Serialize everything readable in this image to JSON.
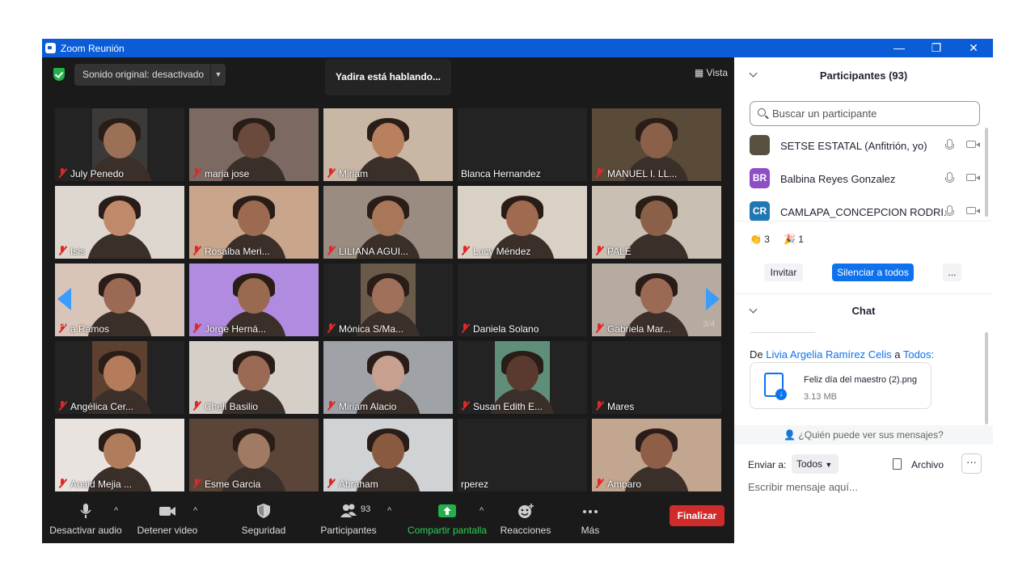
{
  "window": {
    "title": "Zoom Reunión",
    "minimize": "—",
    "restore": "❐",
    "close": "✕"
  },
  "top": {
    "sound_label": "Sonido original: desactivado",
    "speaking": "Yadira está hablando...",
    "view_label": "Vista"
  },
  "gallery": {
    "page_left": "3/4",
    "page_right": "3/4"
  },
  "tiles": [
    {
      "name": "July Penedo",
      "muted": true,
      "video": "person",
      "bg": "#3c3a38",
      "skin": "#9b7057"
    },
    {
      "name": "maria jose",
      "muted": true,
      "video": "person",
      "bg": "#7c6a62",
      "skin": "#6a4a3c"
    },
    {
      "name": "Miriam",
      "muted": true,
      "video": "person",
      "bg": "#c8b7a5",
      "skin": "#b9805f"
    },
    {
      "name": "Blanca Hernandez",
      "muted": false,
      "video": "none"
    },
    {
      "name": "MANUEL I. LL...",
      "muted": true,
      "video": "person",
      "bg": "#5a4a38",
      "skin": "#8a6048"
    },
    {
      "name": "Isis",
      "muted": true,
      "video": "person",
      "bg": "#ddd7cf",
      "skin": "#c08a6a"
    },
    {
      "name": "Rosalba Meri...",
      "muted": true,
      "video": "person",
      "bg": "#c9a58b",
      "skin": "#9b6a50"
    },
    {
      "name": "LILIANA AGUI...",
      "muted": true,
      "video": "person",
      "bg": "#9a8c80",
      "skin": "#a87658"
    },
    {
      "name": "Lucy Méndez",
      "muted": true,
      "video": "person",
      "bg": "#d9d0c6",
      "skin": "#a06a50"
    },
    {
      "name": "PALE",
      "muted": true,
      "video": "person",
      "bg": "#c9bfb3",
      "skin": "#8a6048"
    },
    {
      "name": "a Ramos",
      "muted": true,
      "video": "person",
      "bg": "#d8c4b8",
      "skin": "#9a6a55"
    },
    {
      "name": "Jorge Herná...",
      "muted": true,
      "video": "person",
      "bg": "#b18be0",
      "skin": "#9a6a50"
    },
    {
      "name": "Mónica S/Ma...",
      "muted": true,
      "video": "person",
      "bg": "#6a5a4a",
      "skin": "#a0705a"
    },
    {
      "name": "Daniela Solano",
      "muted": true,
      "video": "none"
    },
    {
      "name": "Gabriela Mar...",
      "muted": true,
      "video": "person",
      "bg": "#b7aaa0",
      "skin": "#9a6a55"
    },
    {
      "name": "Angélica Cer...",
      "muted": true,
      "video": "person",
      "bg": "#5d4030",
      "skin": "#b47c5a"
    },
    {
      "name": "Cheli Basilio",
      "muted": true,
      "video": "person",
      "bg": "#d5cfc8",
      "skin": "#9b6a55"
    },
    {
      "name": "Miriam Alacio",
      "muted": true,
      "video": "person",
      "bg": "#9fa3a8",
      "skin": "#c8a090"
    },
    {
      "name": "Susan Edith E...",
      "muted": true,
      "video": "person",
      "bg": "#5f8f7a",
      "skin": "#5a3a2e"
    },
    {
      "name": "Mares",
      "muted": true,
      "video": "none"
    },
    {
      "name": "Anaid Mejia ...",
      "muted": true,
      "video": "person",
      "bg": "#e8e3de",
      "skin": "#b07c5c"
    },
    {
      "name": "Esme Garcia",
      "muted": true,
      "video": "person",
      "bg": "#5a4538",
      "skin": "#a07a62"
    },
    {
      "name": "Abraham",
      "muted": true,
      "video": "person",
      "bg": "#d0d3d5",
      "skin": "#8a5a40"
    },
    {
      "name": "rperez",
      "muted": false,
      "video": "none"
    },
    {
      "name": "Amparo",
      "muted": true,
      "video": "person",
      "bg": "#c2a690",
      "skin": "#8e5e46"
    }
  ],
  "toolbar": {
    "audio": "Desactivar audio",
    "video": "Detener video",
    "security": "Seguridad",
    "participants": "Participantes",
    "participants_count": "93",
    "share": "Compartir pantalla",
    "reactions": "Reacciones",
    "more": "Más",
    "end": "Finalizar"
  },
  "participants_panel": {
    "title": "Participantes (93)",
    "search_placeholder": "Buscar un participante",
    "list": [
      {
        "initials": "",
        "name": "SETSE ESTATAL (Anfitrión, yo)",
        "color": "#5a5040"
      },
      {
        "initials": "BR",
        "name": "Balbina Reyes Gonzalez",
        "color": "#8e4ec6"
      },
      {
        "initials": "CR",
        "name": "CAMLAPA_CONCEPCION RODRI...",
        "color": "#1f77b4"
      }
    ],
    "reactions": [
      {
        "emoji": "👏",
        "count": "3"
      },
      {
        "emoji": "🎉",
        "count": "1"
      }
    ],
    "invite": "Invitar",
    "mute_all": "Silenciar a todos",
    "more": "..."
  },
  "chat_panel": {
    "title": "Chat",
    "from_prefix": "De",
    "from_name": "Livia Argelia Ramírez Celis",
    "to_word": "a",
    "to_name": "Todos:",
    "file_name": "Feliz día del maestro (2).png",
    "file_size": "3.13 MB",
    "who_sees": "¿Quién puede ver sus mensajes?",
    "send_to_label": "Enviar a:",
    "send_to_value": "Todos",
    "file_button": "Archivo",
    "more": "···",
    "message_placeholder": "Escribir mensaje aquí..."
  },
  "colors": {
    "titlebar": "#0b5cd7",
    "end": "#d12a2a",
    "accent": "#0e72ed",
    "share": "#23b04b"
  }
}
